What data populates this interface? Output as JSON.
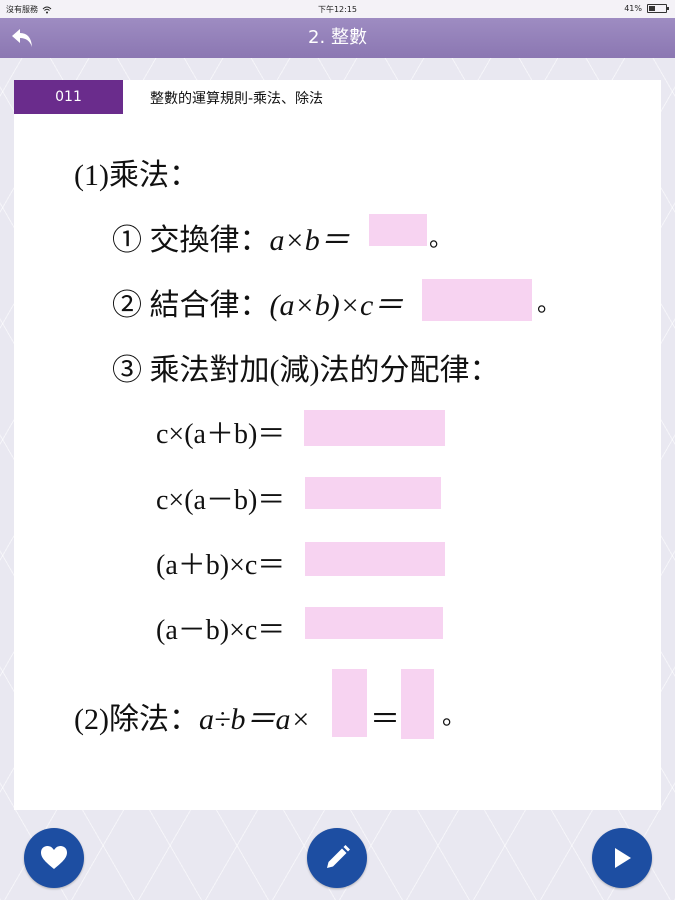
{
  "status_bar": {
    "carrier": "沒有服務",
    "time": "下午12:15",
    "battery": "41%"
  },
  "header": {
    "title": "2. 整數"
  },
  "card": {
    "code": "011",
    "title": "整數的運算規則-乘法、除法"
  },
  "content": {
    "section1_heading": "(1)乘法：",
    "rule1_label": "① 交換律：",
    "rule1_formula": "a×b＝",
    "rule2_label": "② 結合律：",
    "rule2_formula": "(a×b)×c＝",
    "rule3_label": "③ 乘法對加(減)法的分配律：",
    "dist1": "c×(a＋b)＝",
    "dist2": "c×(a－b)＝",
    "dist3": "(a＋b)×c＝",
    "dist4": "(a－b)×c＝",
    "section2_heading": "(2)除法：",
    "division_formula": "a÷b＝a×",
    "equals": "＝",
    "period": "。"
  },
  "colors": {
    "nav": "#8b77b2",
    "badge": "#6a2c8c",
    "blank": "#f7d3f1",
    "footer_button": "#1d4ea2"
  },
  "footer": {
    "icons": [
      "heart-icon",
      "pencil-icon",
      "play-icon"
    ]
  }
}
